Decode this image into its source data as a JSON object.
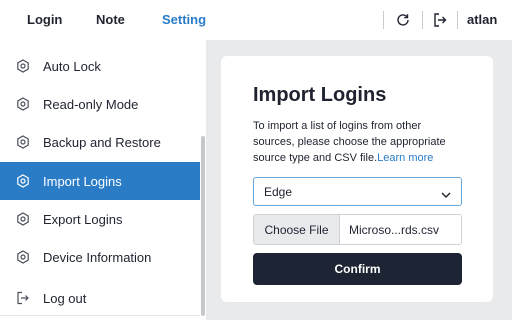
{
  "topbar": {
    "tabs": [
      {
        "label": "Login",
        "active": false
      },
      {
        "label": "Note",
        "active": false
      },
      {
        "label": "Setting",
        "active": true
      }
    ],
    "icons": [
      "refresh-icon",
      "logout-arrow-icon"
    ],
    "user": "atlan"
  },
  "sidebar": {
    "items": [
      {
        "label": "Auto Lock",
        "icon": "gear-icon",
        "active": false
      },
      {
        "label": "Read-only Mode",
        "icon": "gear-icon",
        "active": false
      },
      {
        "label": "Backup and Restore",
        "icon": "gear-icon",
        "active": false
      },
      {
        "label": "Import Logins",
        "icon": "gear-icon",
        "active": true
      },
      {
        "label": "Export Logins",
        "icon": "gear-icon",
        "active": false
      },
      {
        "label": "Device Information",
        "icon": "gear-icon",
        "active": false
      }
    ],
    "logout": {
      "label": "Log out",
      "icon": "logout-icon"
    }
  },
  "main": {
    "title": "Import Logins",
    "description": "To import a list of logins from other sources, please choose the appropriate source type and CSV file.",
    "learn_more": "Learn more",
    "source_select": {
      "value": "Edge"
    },
    "file": {
      "button_label": "Choose File",
      "file_name": "Microso...rds.csv"
    },
    "confirm_label": "Confirm"
  },
  "colors": {
    "accent": "#2a7cc7",
    "active_item_bg": "#2a7cc7",
    "confirm_bg": "#1d2433",
    "main_bg": "#e9eaec"
  }
}
